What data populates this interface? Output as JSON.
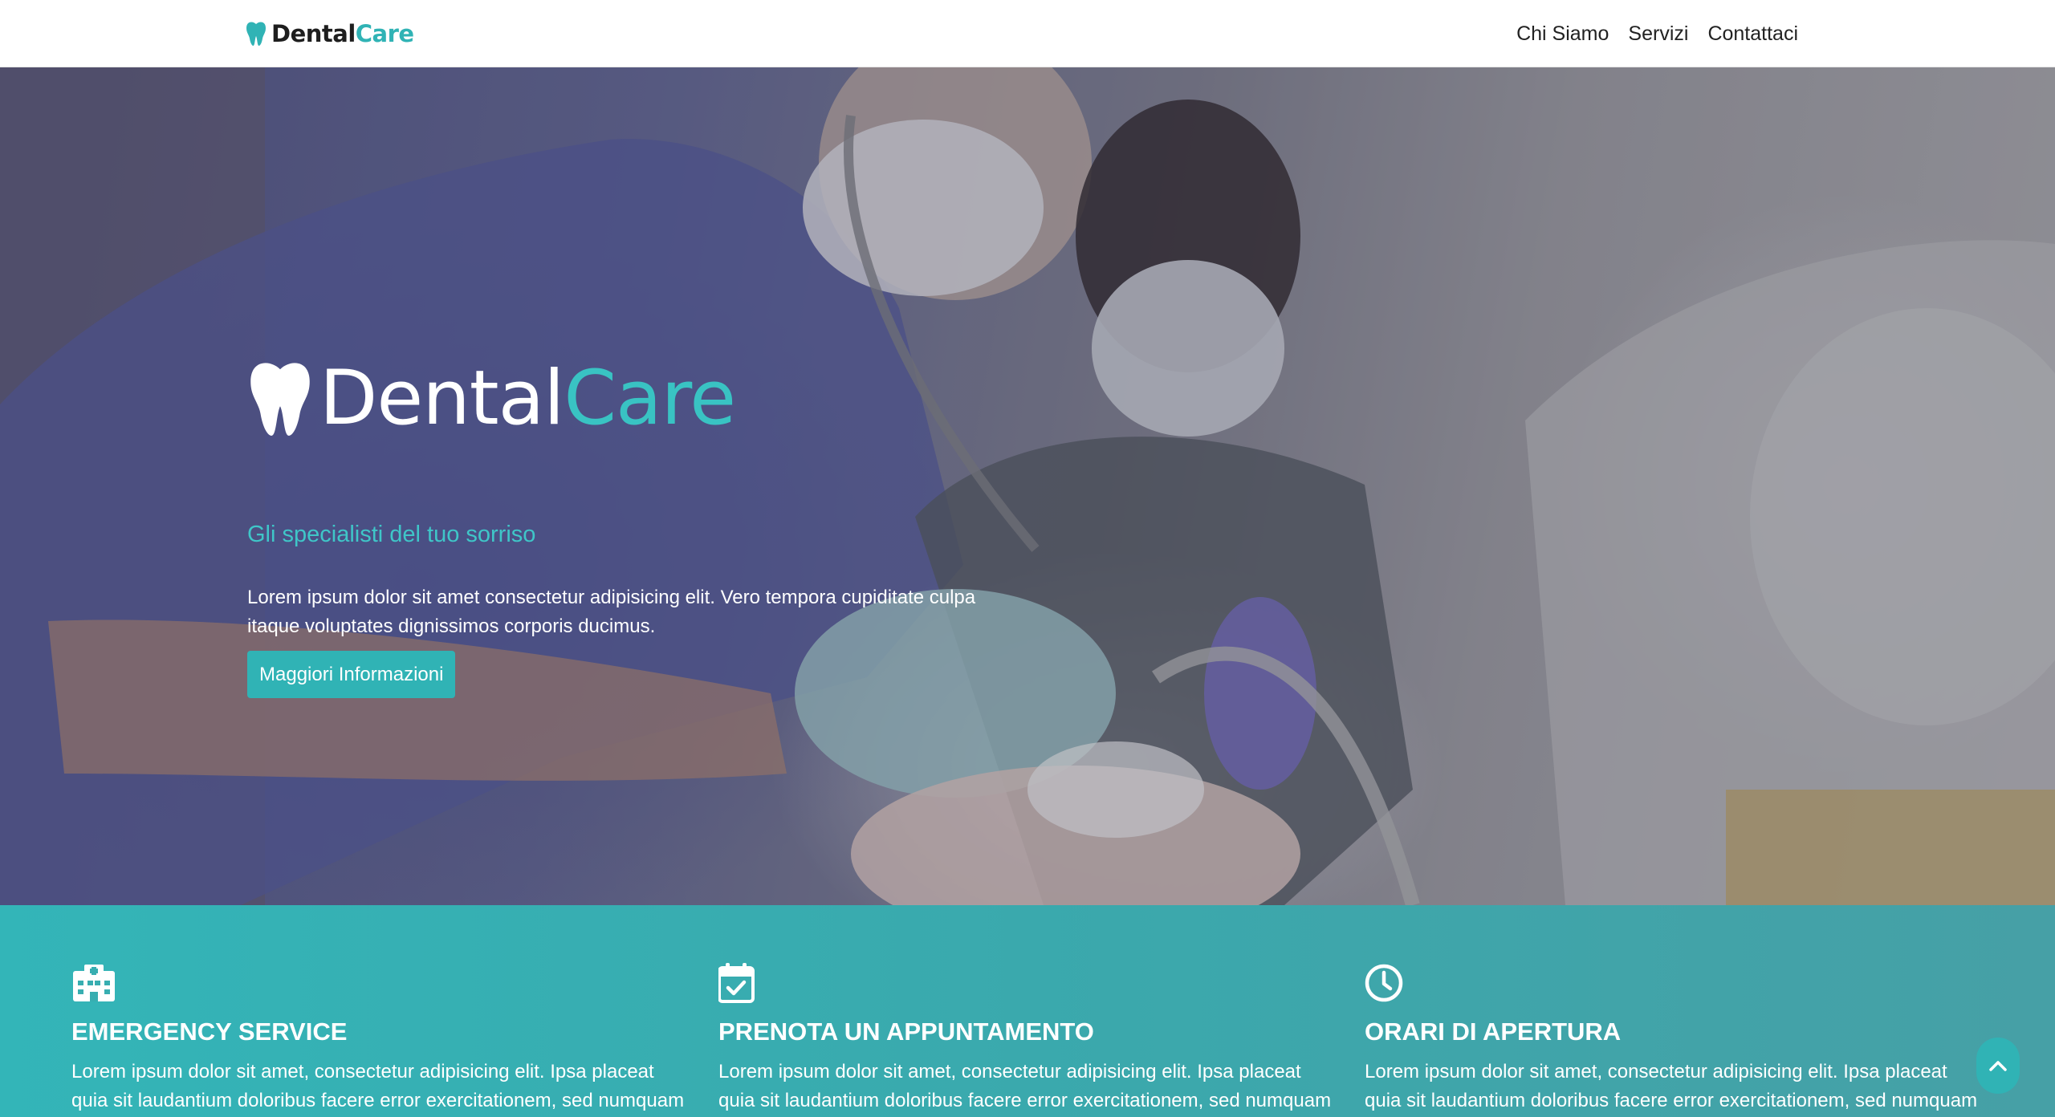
{
  "navbar": {
    "brand_part1": "Dental",
    "brand_part2": "Care",
    "links": [
      "Chi Siamo",
      "Servizi",
      "Contattaci"
    ]
  },
  "hero": {
    "logo_part1": "Dental",
    "logo_part2": "Care",
    "tagline": "Gli specialisti del tuo sorriso",
    "description": "Lorem ipsum dolor sit amet consectetur adipisicing elit. Vero tempora cupiditate culpa itaque voluptates dignissimos corporis ducimus.",
    "button_label": "Maggiori Informazioni"
  },
  "info": [
    {
      "icon": "hospital-icon",
      "title": "EMERGENCY SERVICE",
      "text": "Lorem ipsum dolor sit amet, consectetur adipisicing elit. Ipsa placeat quia sit laudantium doloribus facere error exercitationem, sed numquam"
    },
    {
      "icon": "calendar-check-icon",
      "title": "PRENOTA UN APPUNTAMENTO",
      "text": "Lorem ipsum dolor sit amet, consectetur adipisicing elit. Ipsa placeat quia sit laudantium doloribus facere error exercitationem, sed numquam"
    },
    {
      "icon": "clock-icon",
      "title": "ORARI DI APERTURA",
      "text": "Lorem ipsum dolor sit amet, consectetur adipisicing elit. Ipsa placeat quia sit laudantium doloribus facere error exercitationem, sed numquam"
    }
  ],
  "back_to_top": {
    "icon": "chevron-up-icon"
  },
  "colors": {
    "accent": "#30b3b5",
    "band": "#3aa9ad",
    "text_dark": "#222222"
  }
}
